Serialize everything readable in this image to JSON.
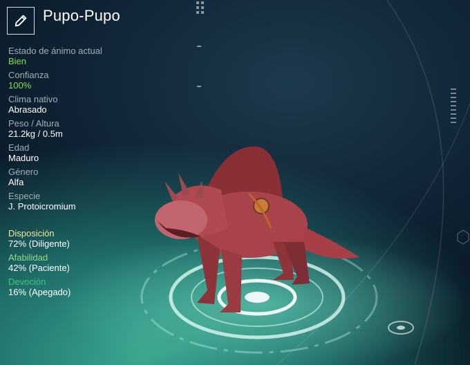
{
  "pet": {
    "name": "Pupo-Pupo",
    "stats": [
      {
        "label": "Estado de ánimo actual",
        "value": "Bien",
        "highlight": true
      },
      {
        "label": "Confianza",
        "value": "100%",
        "highlight": true
      },
      {
        "label": "Clima nativo",
        "value": "Abrasado",
        "highlight": false
      },
      {
        "label": "Peso / Altura",
        "value": "21.2kg / 0.5m",
        "highlight": false
      },
      {
        "label": "Edad",
        "value": "Maduro",
        "highlight": false
      },
      {
        "label": "Género",
        "value": "Alfa",
        "highlight": false
      },
      {
        "label": "Especie",
        "value": "J. Protoicromium",
        "highlight": false
      }
    ],
    "traits": [
      {
        "label": "Disposición",
        "value": "72% (Diligente)",
        "color": "#f1e79a"
      },
      {
        "label": "Afabilidad",
        "value": "42% (Paciente)",
        "color": "#95d98a"
      },
      {
        "label": "Devoción",
        "value": "16% (Apegado)",
        "color": "#3fc57a"
      }
    ]
  },
  "icons": {
    "edit": "pencil-icon"
  },
  "colors": {
    "highlight": "#7fe04f",
    "label": "#9fb0b5"
  }
}
